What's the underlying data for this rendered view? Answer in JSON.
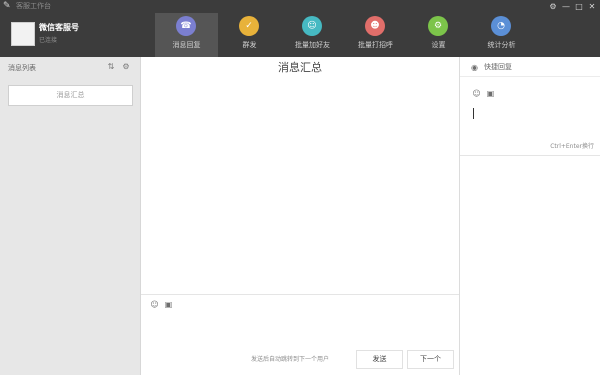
{
  "window": {
    "title": "客服工作台",
    "controls": [
      "设置",
      "最小化",
      "最大化",
      "关闭"
    ]
  },
  "profile": {
    "name": "微信客服号",
    "status": "已连接"
  },
  "nav": {
    "items": [
      {
        "label": "消息回复",
        "icon": "reply-icon",
        "color": "#7b7fd0"
      },
      {
        "label": "群发",
        "icon": "broadcast-icon",
        "color": "#e8b23a"
      },
      {
        "label": "批量加好友",
        "icon": "add-friend-icon",
        "color": "#46b9c2"
      },
      {
        "label": "批量打招呼",
        "icon": "greet-icon",
        "color": "#e16e6a"
      },
      {
        "label": "设置",
        "icon": "settings-icon",
        "color": "#7cc44a"
      },
      {
        "label": "统计分析",
        "icon": "stats-icon",
        "color": "#5b8fd6"
      }
    ]
  },
  "left_panel": {
    "title": "消息列表",
    "summary_button": "消息汇总"
  },
  "center": {
    "title": "消息汇总",
    "hint": "发送后自动跳转到下一个用户",
    "send_label": "发送",
    "next_label": "下一个"
  },
  "right_panel": {
    "title": "快捷回复",
    "tip": "Ctrl+Enter换行"
  },
  "colors": {
    "topbar": "#3c3c3c",
    "active_tab": "#555555",
    "left_bg": "#e7e7e7"
  }
}
